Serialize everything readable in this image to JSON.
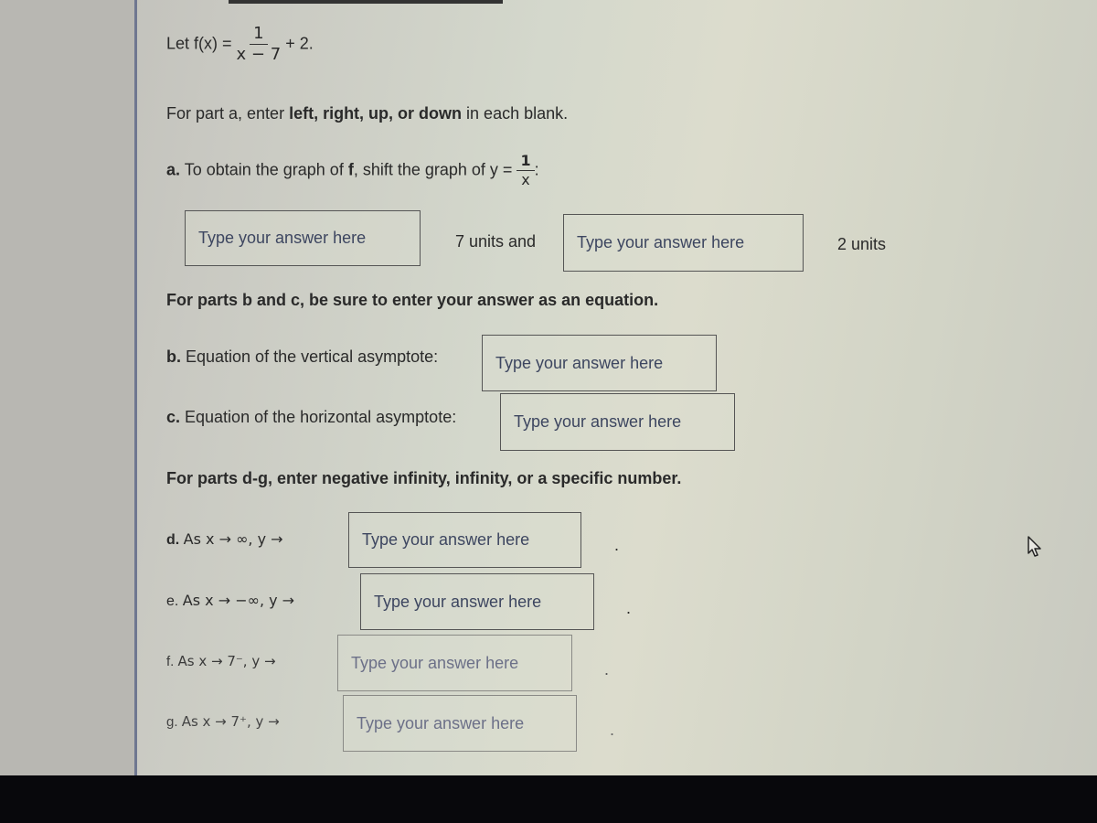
{
  "header": {
    "function_prefix": "Let f(x) =",
    "function_numerator": "1",
    "function_denominator": "x − 7",
    "function_suffix": "+ 2."
  },
  "part_a": {
    "instruction_pre": "For part a, enter ",
    "instruction_bold": "left, right, up, or down",
    "instruction_post": " in each blank.",
    "label_letter": "a.",
    "label_text": " To obtain the graph of ",
    "label_f": "f",
    "label_text2": ", shift the graph of y =",
    "base_numerator": "1",
    "base_denominator": "x",
    "base_suffix": ":",
    "input1_placeholder": "Type your answer here",
    "between_text": "7 units and",
    "input2_placeholder": "Type your answer here",
    "after_text": "2 units"
  },
  "parts_bc": {
    "instruction": "For parts b and c, be sure to enter your answer as an equation.",
    "b_letter": "b.",
    "b_label": " Equation of the vertical asymptote:",
    "b_placeholder": "Type your answer here",
    "c_letter": "c.",
    "c_label": " Equation of the horizontal asymptote:",
    "c_placeholder": "Type your answer here"
  },
  "parts_dg": {
    "instruction": "For parts d-g, enter negative infinity, infinity, or a specific number.",
    "items": [
      {
        "letter": "d.",
        "label": "As x → ∞, y →",
        "placeholder": "Type your answer here",
        "end": "."
      },
      {
        "letter": "e.",
        "label": "As x → −∞, y →",
        "placeholder": "Type your answer here",
        "end": "."
      },
      {
        "letter": "f.",
        "label": "As x → 7⁻, y →",
        "placeholder": "Type your answer here",
        "end": "."
      },
      {
        "letter": "g.",
        "label": "As x → 7⁺, y →",
        "placeholder": "Type your answer here",
        "end": "."
      }
    ]
  },
  "icons": {
    "cursor": "mouse-pointer-icon"
  }
}
